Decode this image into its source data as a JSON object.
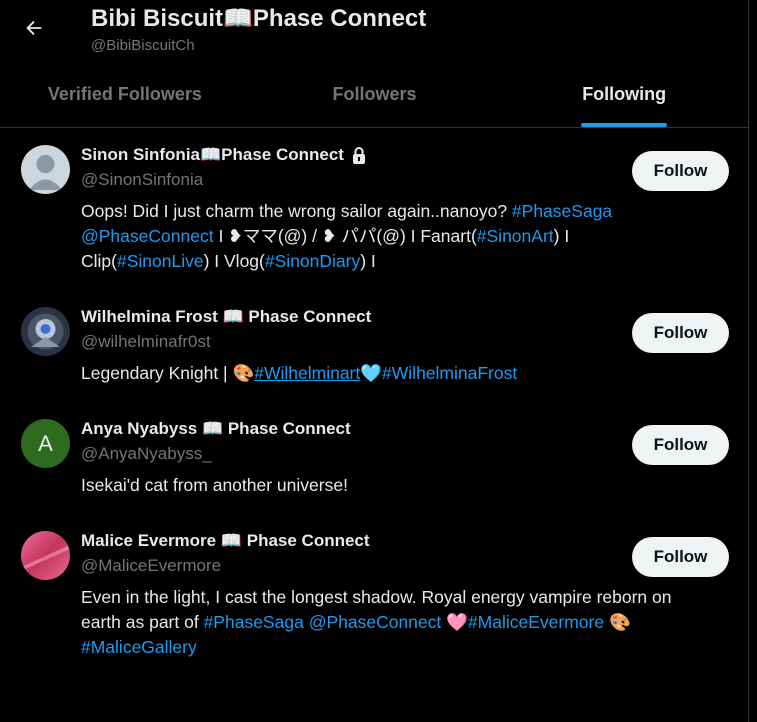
{
  "header": {
    "title": "Bibi Biscuit📖Phase Connect",
    "handle": "@BibiBiscuitCh",
    "back_icon": "arrow-left-icon"
  },
  "tabs": [
    {
      "label": "Verified Followers",
      "active": false
    },
    {
      "label": "Followers",
      "active": false
    },
    {
      "label": "Following",
      "active": true
    }
  ],
  "users": [
    {
      "name": "Sinon Sinfonia📖Phase Connect",
      "handle": "@SinonSinfonia",
      "locked": true,
      "follow_label": "Follow",
      "avatar": "default-avatar",
      "bio_line1_text": "Oops! Did I just charm the wrong sailor again..nanoyo? ",
      "bio_line1_tag": "#PhaseSaga",
      "bio_line2_link": "@PhaseConnect",
      "bio_line2_text": " I ❥ママ(@) / ❥ パパ(@) I Fanart(",
      "bio_line2_tag": "#SinonArt",
      "bio_line2_end": ") I",
      "bio_line3_a": "Clip(",
      "bio_line3_tag1": "#SinonLive",
      "bio_line3_b": ") I Vlog(",
      "bio_line3_tag2": "#SinonDiary",
      "bio_line3_c": ") I"
    },
    {
      "name": "Wilhelmina Frost 📖 Phase Connect",
      "handle": "@wilhelminafr0st",
      "locked": false,
      "follow_label": "Follow",
      "avatar": "wilhelmina-avatar",
      "bio_text": "Legendary Knight | 🎨",
      "bio_tag1": "#Wilhelminart",
      "bio_heart": "🩵",
      "bio_tag2": "#WilhelminaFrost"
    },
    {
      "name": "Anya Nyabyss 📖 Phase Connect",
      "handle": "@AnyaNyabyss_",
      "locked": false,
      "follow_label": "Follow",
      "avatar_letter": "A",
      "bio_text": "Isekai'd cat from another universe!"
    },
    {
      "name": "Malice Evermore 📖 Phase Connect",
      "handle": "@MaliceEvermore",
      "locked": false,
      "follow_label": "Follow",
      "avatar": "malice-avatar",
      "bio_line1": "Even in the light, I cast the longest shadow. Royal energy vampire reborn on",
      "bio_line2_text": "earth as part of ",
      "bio_line2_tag1": "#PhaseSaga",
      "bio_line2_link": "@PhaseConnect",
      "bio_line2_heart": "🩷",
      "bio_line2_tag2": "#MaliceEvermore",
      "bio_line2_emoji": "🎨",
      "bio_line3_tag": "#MaliceGallery"
    }
  ],
  "colors": {
    "accent": "#1d9bf0",
    "text": "#e7e9ea",
    "muted": "#71767b",
    "background": "#000000"
  }
}
